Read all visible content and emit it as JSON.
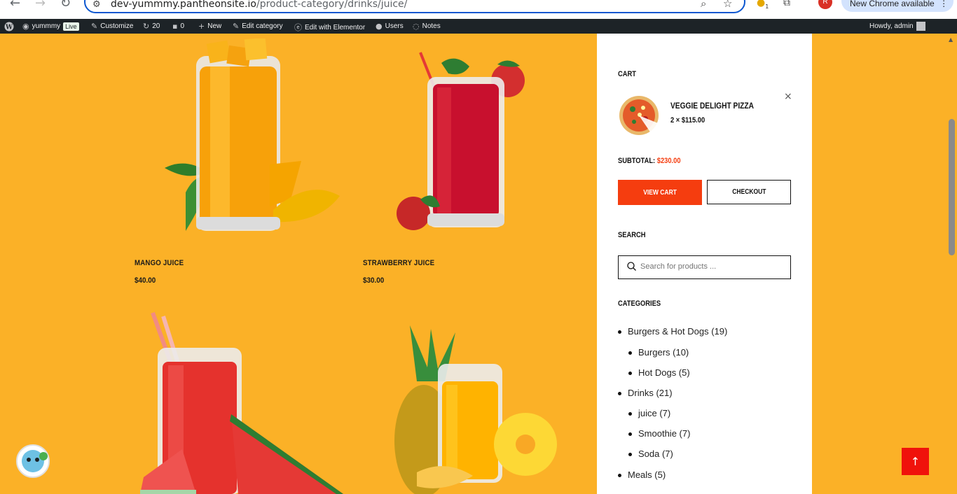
{
  "browser": {
    "url_host": "dev-yummmy.pantheonsite.io",
    "url_path": "/product-category/drinks/juice/",
    "update_label": "New Chrome available",
    "ext_badge": "1",
    "avatar_letter": "R"
  },
  "adminbar": {
    "site_name": "yummmy",
    "live_badge": "Live",
    "customize": "Customize",
    "updates_count": "20",
    "comments_count": "0",
    "new_label": "New",
    "edit_category": "Edit category",
    "elementor": "Edit with Elementor",
    "users": "Users",
    "notes": "Notes",
    "howdy": "Howdy, admin"
  },
  "products": [
    {
      "name": "MANGO JUICE",
      "price": "$40.00"
    },
    {
      "name": "STRAWBERRY JUICE",
      "price": "$30.00"
    }
  ],
  "cart": {
    "title": "CART",
    "item_name": "VEGGIE DELIGHT PIZZA",
    "item_qty": "2 × $115.00",
    "subtotal_label": "SUBTOTAL:",
    "subtotal_amount": "$230.00",
    "view_cart": "VIEW CART",
    "checkout": "CHECKOUT",
    "remove_symbol": "×"
  },
  "search": {
    "title": "SEARCH",
    "placeholder": "Search for products ..."
  },
  "categories": {
    "title": "CATEGORIES",
    "items": [
      {
        "label": "Burgers & Hot Dogs (19)",
        "level": 0
      },
      {
        "label": "Burgers (10)",
        "level": 1
      },
      {
        "label": "Hot Dogs (5)",
        "level": 1
      },
      {
        "label": "Drinks (21)",
        "level": 0
      },
      {
        "label": "juice (7)",
        "level": 1
      },
      {
        "label": "Smoothie (7)",
        "level": 1
      },
      {
        "label": "Soda (7)",
        "level": 1
      },
      {
        "label": "Meals (5)",
        "level": 0
      }
    ]
  },
  "colors": {
    "page_bg": "#fbb127",
    "accent": "#f53d0f",
    "admin_bar": "#1d2327"
  },
  "icons": {
    "back": "arrow-left-icon",
    "forward": "arrow-right-icon",
    "reload": "reload-icon",
    "search": "search-icon",
    "star": "star-icon",
    "to_top": "arrow-up-icon"
  }
}
